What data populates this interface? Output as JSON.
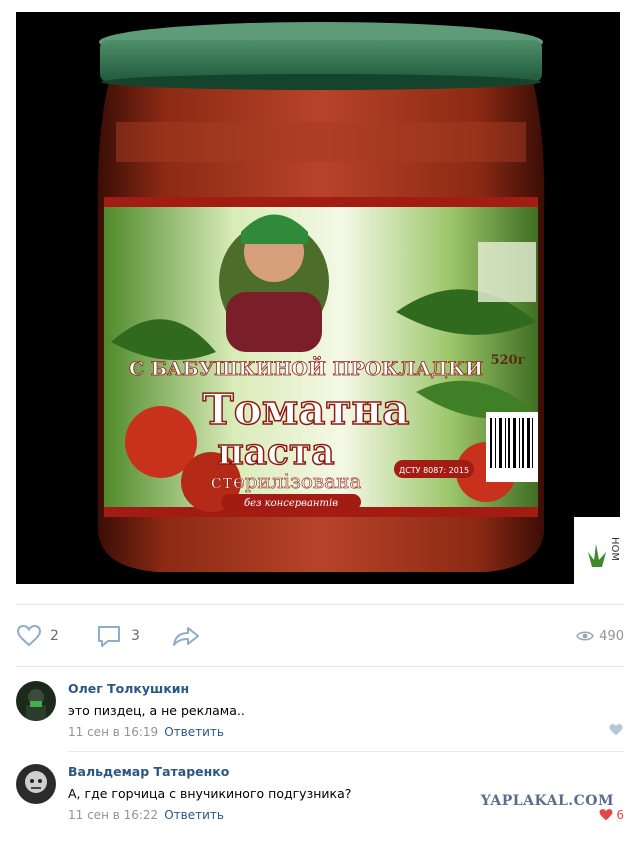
{
  "post": {
    "image": {
      "alt_text": "",
      "label_top_text": "С БАБУШКИНОЙ ПРОКЛАДКИ",
      "label_main_1": "Томатна",
      "label_main_2": "паста",
      "label_sub": "стерилізована",
      "label_small": "без консервантів",
      "dstu": "ДСТУ 8087: 2015",
      "weight": "520г",
      "side_watermark": "НОМ"
    },
    "likes_count": "2",
    "comments_count": "3",
    "views_count": "490"
  },
  "comments": [
    {
      "author": "Олег Толкушкин",
      "text": "это пиздец, а не реклама..",
      "time": "11 сен в 16:19",
      "reply_label": "Ответить",
      "likes": ""
    },
    {
      "author": "Вальдемар Татаренко",
      "text": "А, где горчица с внучикиного подгузника?",
      "time": "11 сен в 16:22",
      "reply_label": "Ответить",
      "likes": "6"
    }
  ],
  "watermark": "YAPLAKAL.COM",
  "colors": {
    "link": "#2a5885",
    "muted": "#939393",
    "icon": "#8fadc8",
    "like_red": "#e64646"
  }
}
